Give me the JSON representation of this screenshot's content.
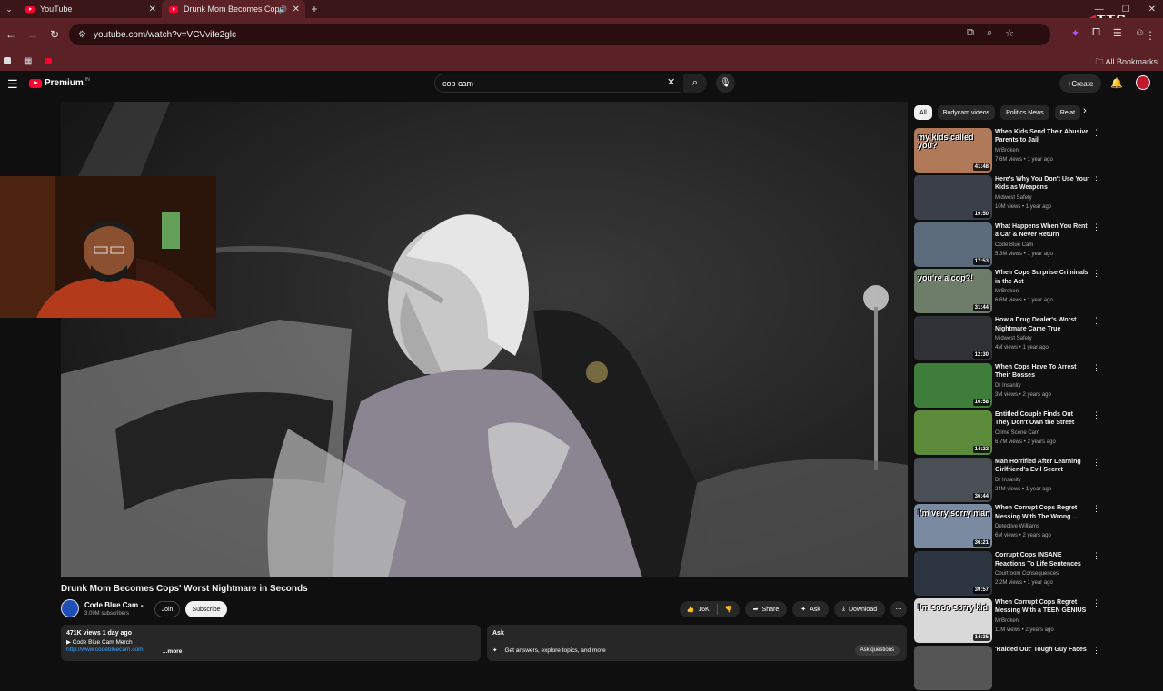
{
  "browser": {
    "tabs": [
      {
        "label": "YouTube"
      },
      {
        "label": "Drunk Mom Becomes Cops"
      }
    ],
    "url": "youtube.com/watch?v=VCVvife2glc",
    "all_bookmarks": "All Bookmarks",
    "overlay_logo": "TTS"
  },
  "youtube": {
    "logo_text": "Premium",
    "logo_sup": "IN",
    "search_value": "cop cam",
    "create_label": "Create"
  },
  "video": {
    "title": "Drunk Mom Becomes Cops' Worst Nightmare in Seconds",
    "channel": "Code Blue Cam",
    "subscribers": "3.09M subscribers",
    "join": "Join",
    "subscribe": "Subscribe",
    "likes": "16K",
    "share": "Share",
    "ask": "Ask",
    "download": "Download",
    "desc_meta": "471K views  1 day ago",
    "desc_line1": "▶ Code Blue Cam Merch",
    "desc_link": "http://www.codebluecam.com",
    "desc_more": "...more",
    "ask_title": "Ask",
    "ask_prompt": "Get answers, explore topics, and more",
    "ask_button": "Ask questions"
  },
  "chips": [
    "All",
    "Bodycam videos",
    "Politics News",
    "Relat"
  ],
  "recommendations": [
    {
      "title": "When Kids Send Their Abusive Parents to Jail",
      "channel": "MrBroken",
      "meta": "7.6M views • 1 year ago",
      "duration": "41:48",
      "thumb_text": "my kids called you?",
      "color": "#b07a5a"
    },
    {
      "title": "Here's Why You Don't Use Your Kids as Weapons",
      "channel": "Midwest Safety",
      "meta": "10M views • 1 year ago",
      "duration": "19:50",
      "thumb_text": "",
      "color": "#3b3f4a"
    },
    {
      "title": "What Happens When You Rent a Car & Never Return",
      "channel": "Code Blue Cam",
      "meta": "5.3M views • 1 year ago",
      "duration": "17:53",
      "thumb_text": "",
      "color": "#5b6b7c"
    },
    {
      "title": "When Cops Surprise Criminals in the Act",
      "channel": "MrBroken",
      "meta": "6.6M views • 1 year ago",
      "duration": "31:44",
      "thumb_text": "you're a cop?!",
      "color": "#6d7d6a"
    },
    {
      "title": "How a Drug Dealer's Worst Nightmare Came True",
      "channel": "Midwest Safety",
      "meta": "4M views • 1 year ago",
      "duration": "12:30",
      "thumb_text": "",
      "color": "#2f3136"
    },
    {
      "title": "When Cops Have To Arrest Their Bosses",
      "channel": "Dr Insanity",
      "meta": "3M views • 2 years ago",
      "duration": "16:58",
      "thumb_text": "",
      "color": "#3f7d3a"
    },
    {
      "title": "Entitled Couple Finds Out They Don't Own the Street",
      "channel": "Crime Scene Cam",
      "meta": "6.7M views • 2 years ago",
      "duration": "14:22",
      "thumb_text": "",
      "color": "#5a8a3a"
    },
    {
      "title": "Man Horrified After Learning Girlfriend's Evil Secret",
      "channel": "Dr Insanity",
      "meta": "24M views • 1 year ago",
      "duration": "36:44",
      "thumb_text": "",
      "color": "#4a4e55"
    },
    {
      "title": "When Corrupt Cops Regret Messing With The Wrong ...",
      "channel": "Detective Williams",
      "meta": "6M views • 2 years ago",
      "duration": "36:21",
      "thumb_text": "I'm very sorry man",
      "color": "#7a8aa0"
    },
    {
      "title": "Corrupt Cops INSANE Reactions To Life Sentences",
      "channel": "Courtroom Consequences",
      "meta": "2.2M views • 1 year ago",
      "duration": "39:57",
      "thumb_text": "",
      "color": "#2c3540"
    },
    {
      "title": "When Corrupt Cops Regret Messing With a TEEN GENIUS",
      "channel": "MrBroken",
      "meta": "11M views • 2 years ago",
      "duration": "14:35",
      "thumb_text": "I'm sooo sorry kid",
      "color": "#d9d9d9"
    },
    {
      "title": "'Raided Out' Tough Guy Faces",
      "channel": "",
      "meta": "",
      "duration": "",
      "thumb_text": "",
      "color": "#555"
    }
  ]
}
